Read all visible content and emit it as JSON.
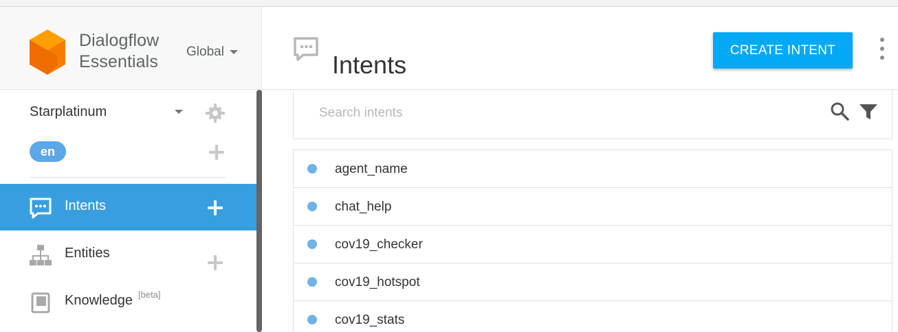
{
  "brand": {
    "line1": "Dialogflow",
    "line2": "Essentials",
    "region": "Global"
  },
  "agent": {
    "name": "Starplatinum",
    "language": "en"
  },
  "sidebar": {
    "items": [
      {
        "label": "Intents",
        "icon": "chat-bubble-icon",
        "active": true
      },
      {
        "label": "Entities",
        "icon": "hierarchy-icon",
        "active": false
      },
      {
        "label": "Knowledge",
        "badge": "[beta]",
        "icon": "book-icon",
        "active": false
      }
    ]
  },
  "header": {
    "title": "Intents",
    "icon": "chat-bubble-icon",
    "create_label": "CREATE INTENT",
    "more_icon": "more-vertical-icon"
  },
  "search": {
    "placeholder": "Search intents",
    "value": "",
    "search_icon": "search-icon",
    "filter_icon": "filter-icon"
  },
  "intents": [
    {
      "name": "agent_name"
    },
    {
      "name": "chat_help"
    },
    {
      "name": "cov19_checker"
    },
    {
      "name": "cov19_hotspot"
    },
    {
      "name": "cov19_stats"
    }
  ],
  "colors": {
    "accent": "#03a9f4",
    "active_nav": "#379fe0",
    "language_pill": "#5ba7e7",
    "intent_dot": "#6fb2e8",
    "logo_orange": "#ef6c00",
    "text_primary": "#333333"
  }
}
